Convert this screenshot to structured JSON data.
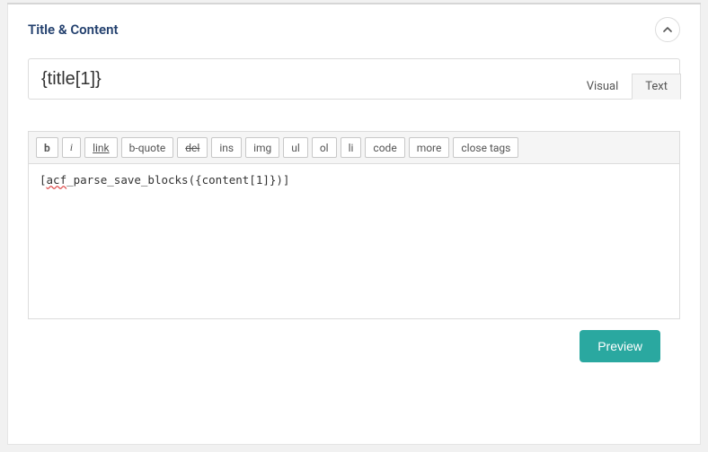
{
  "panel": {
    "title": "Title & Content",
    "collapse_icon": "chevron-up"
  },
  "title_input": {
    "value": "{title[1]}"
  },
  "editor": {
    "tabs": {
      "visual": "Visual",
      "text": "Text",
      "active": "text"
    },
    "toolbar": {
      "bold": "b",
      "italic": "i",
      "link": "link",
      "bquote": "b-quote",
      "del": "del",
      "ins": "ins",
      "img": "img",
      "ul": "ul",
      "ol": "ol",
      "li": "li",
      "code": "code",
      "more": "more",
      "close_tags": "close tags"
    },
    "content_prefix": "[",
    "content_squiggle": "acf",
    "content_rest": "_parse_save_blocks({content[1]})]"
  },
  "footer": {
    "preview": "Preview"
  }
}
